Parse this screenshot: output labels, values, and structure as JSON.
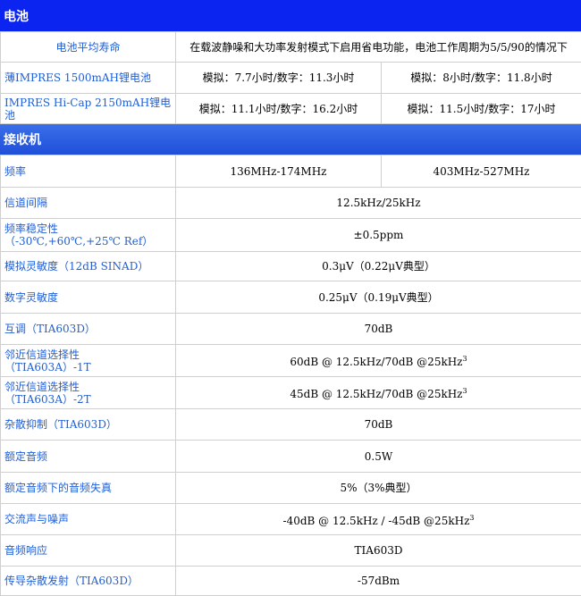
{
  "battery": {
    "title": "电池",
    "life_label": "电池平均寿命",
    "life_desc": "在载波静噪和大功率发射模式下启用省电功能，电池工作周期为5/5/90的情况下",
    "rows": [
      {
        "label": "薄IMPRES 1500mAH锂电池",
        "a": "模拟：7.7小时/数字：11.3小时",
        "b": "模拟：8小时/数字：11.8小时"
      },
      {
        "label": "IMPRES Hi-Cap 2150mAH锂电池",
        "a": "模拟：11.1小时/数字：16.2小时",
        "b": "模拟：11.5小时/数字：17小时"
      }
    ]
  },
  "receiver": {
    "title": "接收机",
    "rows": [
      {
        "label": "频率",
        "a": "136MHz-174MHz",
        "b": "403MHz-527MHz"
      },
      {
        "label": "信道间隔",
        "value": "12.5kHz/25kHz"
      },
      {
        "label": "频率稳定性",
        "label2": "（-30℃,+60℃,+25℃ Ref）",
        "value": "±0.5ppm"
      },
      {
        "label": "模拟灵敏度（12dB SINAD）",
        "value": "0.3μV（0.22μV典型）"
      },
      {
        "label": "数字灵敏度",
        "value": "0.25μV（0.19μV典型）"
      },
      {
        "label": "互调（TIA603D）",
        "value": "70dB"
      },
      {
        "label": "邻近信道选择性",
        "label2": "（TIA603A）-1T",
        "value": "60dB @ 12.5kHz/70dB @25kHz",
        "sup": "3"
      },
      {
        "label": "邻近信道选择性",
        "label2": "（TIA603A）-2T",
        "value": "45dB  @ 12.5kHz/70dB @25kHz",
        "sup": "3"
      },
      {
        "label": "杂散抑制（TIA603D）",
        "value": "70dB"
      },
      {
        "label": "额定音频",
        "value": "0.5W"
      },
      {
        "label": "额定音频下的音频失真",
        "value": "5%（3%典型）"
      },
      {
        "label": "交流声与噪声",
        "value": "-40dB  @ 12.5kHz / -45dB @25kHz",
        "sup": "3"
      },
      {
        "label": "音频响应",
        "value": "TIA603D"
      },
      {
        "label": "传导杂散发射（TIA603D）",
        "value": "-57dBm"
      }
    ]
  }
}
